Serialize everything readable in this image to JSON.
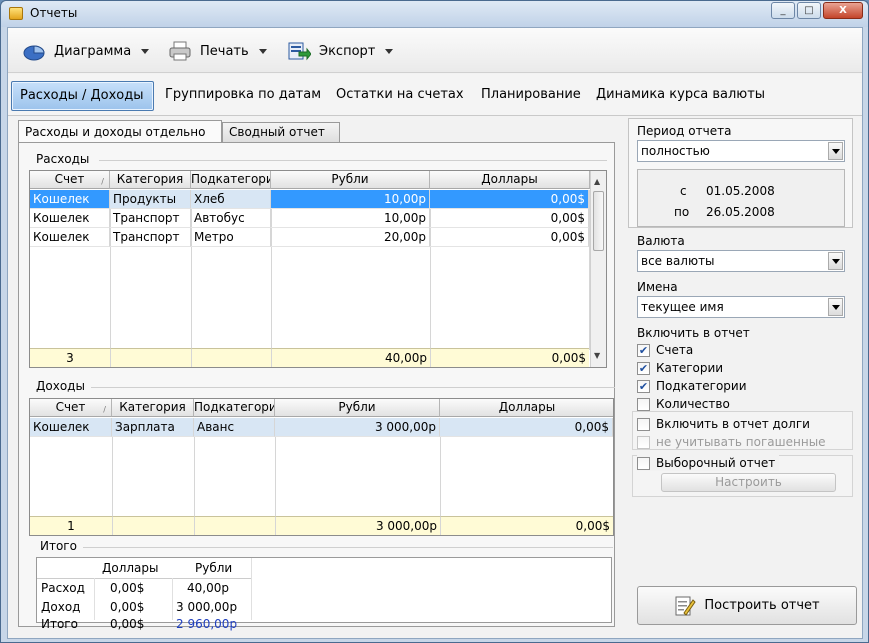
{
  "window": {
    "title": "Отчеты",
    "min": "_",
    "max": "□",
    "close": "X"
  },
  "toolbar": {
    "diagram": "Диаграмма",
    "print": "Печать",
    "export": "Экспорт"
  },
  "nav": {
    "tabs": [
      "Расходы / Доходы",
      "Группировка по датам",
      "Остатки на счетах",
      "Планирование",
      "Динамика курса валюты"
    ]
  },
  "subtabs": [
    "Расходы и доходы отдельно",
    "Сводный отчет"
  ],
  "expenses": {
    "label": "Расходы",
    "headers": [
      "Счет",
      "Категория",
      "Подкатегория",
      "Рубли",
      "Доллары"
    ],
    "rows": [
      [
        "Кошелек",
        "Продукты",
        "Хлеб",
        "10,00р",
        "0,00$"
      ],
      [
        "Кошелек",
        "Транспорт",
        "Автобус",
        "10,00р",
        "0,00$"
      ],
      [
        "Кошелек",
        "Транспорт",
        "Метро",
        "20,00р",
        "0,00$"
      ]
    ],
    "footer": {
      "count": "3",
      "rub": "40,00р",
      "usd": "0,00$"
    }
  },
  "incomes": {
    "label": "Доходы",
    "headers": [
      "Счет",
      "Категория",
      "Подкатегория",
      "Рубли",
      "Доллары"
    ],
    "rows": [
      [
        "Кошелек",
        "Зарплата",
        "Аванс",
        "3 000,00р",
        "0,00$"
      ]
    ],
    "footer": {
      "count": "1",
      "rub": "3 000,00р",
      "usd": "0,00$"
    }
  },
  "totals": {
    "label": "Итого",
    "headers": [
      "Доллары",
      "Рубли"
    ],
    "rows": [
      {
        "name": "Расход",
        "usd": "0,00$",
        "rub": "40,00р"
      },
      {
        "name": "Доход",
        "usd": "0,00$",
        "rub": "3 000,00р"
      },
      {
        "name": "Итого",
        "usd": "0,00$",
        "rub": "2 960,00р"
      }
    ],
    "balance_color": "#1f3fbf"
  },
  "period": {
    "label": "Период отчета",
    "value": "полностью",
    "from_label": "с",
    "from": "01.05.2008",
    "to_label": "по",
    "to": "26.05.2008"
  },
  "currency": {
    "label": "Валюта",
    "value": "все валюты"
  },
  "names": {
    "label": "Имена",
    "value": "текущее имя"
  },
  "include": {
    "label": "Включить в отчет",
    "items": [
      {
        "label": "Счета",
        "checked": true
      },
      {
        "label": "Категории",
        "checked": true
      },
      {
        "label": "Подкатегории",
        "checked": true
      },
      {
        "label": "Количество",
        "checked": false
      }
    ]
  },
  "debts": {
    "label": "Включить в отчет долги",
    "checked": false,
    "sub": "не учитывать погашенные",
    "sub_checked": false
  },
  "selective": {
    "label": "Выборочный отчет",
    "checked": false,
    "configure": "Настроить"
  },
  "build": "Построить отчет"
}
